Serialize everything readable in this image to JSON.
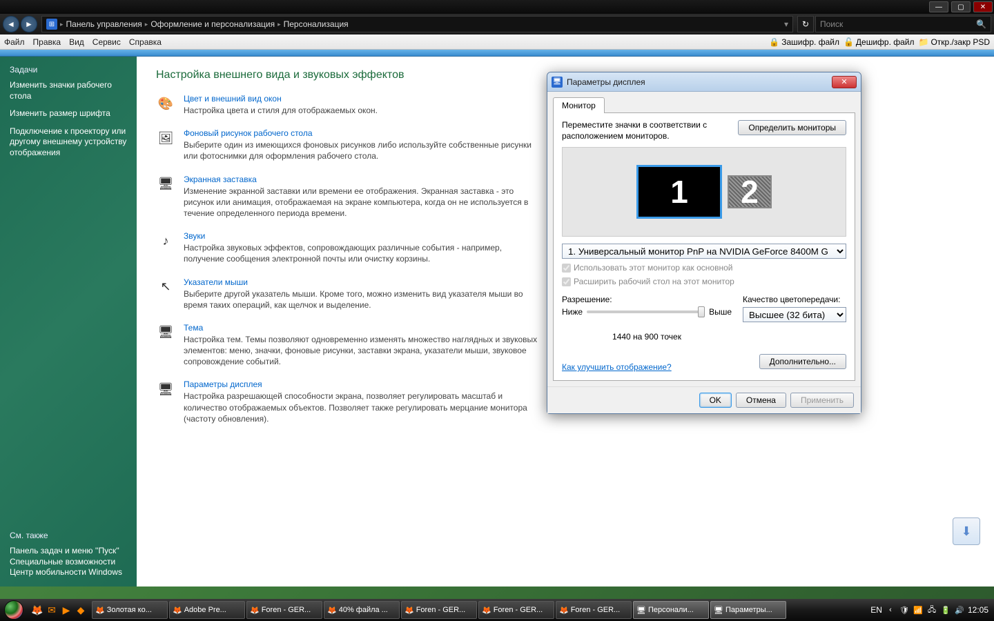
{
  "titlebar": {
    "minimize": "—",
    "maximize": "▢",
    "close": "✕"
  },
  "navbar": {
    "breadcrumb": [
      "Панель управления",
      "Оформление и персонализация",
      "Персонализация"
    ],
    "search_placeholder": "Поиск"
  },
  "menubar": {
    "items": [
      "Файл",
      "Правка",
      "Вид",
      "Сервис",
      "Справка"
    ],
    "right": [
      "Зашифр. файл",
      "Дешифр. файл",
      "Откр./закр PSD"
    ]
  },
  "sidebar": {
    "heading": "Задачи",
    "links": [
      "Изменить значки рабочего стола",
      "Изменить размер шрифта",
      "Подключение к проектору или другому внешнему устройству отображения"
    ],
    "see_also_heading": "См. также",
    "see_also": [
      "Панель задач и меню ''Пуск''",
      "Специальные возможности",
      "Центр мобильности Windows"
    ]
  },
  "main": {
    "title": "Настройка внешнего вида и звуковых эффектов",
    "settings": [
      {
        "icon": "🎨",
        "title": "Цвет и внешний вид окон",
        "desc": "Настройка цвета и стиля для отображаемых окон."
      },
      {
        "icon": "🖼",
        "title": "Фоновый рисунок рабочего стола",
        "desc": "Выберите один из имеющихся фоновых рисунков либо используйте собственные рисунки или фотоснимки для оформления рабочего стола."
      },
      {
        "icon": "🖥",
        "title": "Экранная заставка",
        "desc": "Изменение экранной заставки или времени ее отображения. Экранная заставка - это рисунок или анимация, отображаемая на экране компьютера, когда он не используется в течение определенного периода времени."
      },
      {
        "icon": "♪",
        "title": "Звуки",
        "desc": "Настройка звуковых эффектов, сопровождающих различные события - например, получение сообщения электронной почты или очистку корзины."
      },
      {
        "icon": "↖",
        "title": "Указатели мыши",
        "desc": "Выберите другой указатель мыши. Кроме того, можно изменить вид указателя мыши во время таких операций, как щелчок и выделение."
      },
      {
        "icon": "🖥",
        "title": "Тема",
        "desc": "Настройка тем. Темы позволяют одновременно изменять множество наглядных и звуковых элементов: меню, значки, фоновые рисунки, заставки экрана, указатели мыши, звуковое сопровождение событий."
      },
      {
        "icon": "🖥",
        "title": "Параметры дисплея",
        "desc": "Настройка разрешающей способности экрана, позволяет регулировать масштаб и количество отображаемых объектов. Позволяет также регулировать мерцание монитора (частоту обновления)."
      }
    ]
  },
  "dialog": {
    "title": "Параметры дисплея",
    "tab": "Монитор",
    "instruction": "Переместите значки в соответствии с расположением мониторов.",
    "identify_btn": "Определить мониторы",
    "monitors": [
      "1",
      "2"
    ],
    "monitor_select": "1. Универсальный монитор PnP на NVIDIA GeForce 8400M G",
    "check_primary": "Использовать этот монитор как основной",
    "check_extend": "Расширить рабочий стол на этот монитор",
    "resolution_label": "Разрешение:",
    "slider_low": "Ниже",
    "slider_high": "Выше",
    "resolution_value": "1440 на 900 точек",
    "color_label": "Качество цветопередачи:",
    "color_value": "Высшее (32 бита)",
    "help_link": "Как улучшить отображение?",
    "advanced_btn": "Дополнительно...",
    "ok": "OK",
    "cancel": "Отмена",
    "apply": "Применить"
  },
  "taskbar": {
    "items": [
      "Золотая ко...",
      "Adobe Pre...",
      "Foren - GER...",
      "40% файла ...",
      "Foren - GER...",
      "Foren - GER...",
      "Foren - GER...",
      "Персонали...",
      "Параметры..."
    ],
    "lang": "EN",
    "clock": "12:05"
  }
}
